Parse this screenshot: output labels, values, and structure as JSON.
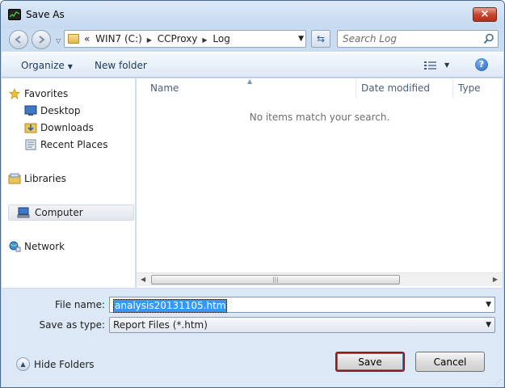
{
  "window": {
    "title": "Save As",
    "close_label": "×"
  },
  "address": {
    "crumbs": [
      "WIN7 (C:)",
      "CCProxy",
      "Log"
    ],
    "overflow": "«"
  },
  "search": {
    "placeholder": "Search Log"
  },
  "toolbar": {
    "organize": "Organize",
    "new_folder": "New folder",
    "help": "?"
  },
  "navpane": {
    "favorites": "Favorites",
    "favorite_items": [
      "Desktop",
      "Downloads",
      "Recent Places"
    ],
    "libraries": "Libraries",
    "computer": "Computer",
    "network": "Network"
  },
  "content": {
    "columns": [
      "Name",
      "Date modified",
      "Type"
    ],
    "empty_message": "No items match your search."
  },
  "form": {
    "file_name_label": "File name:",
    "file_name_value": "analysis20131105.htm",
    "save_type_label": "Save as type:",
    "save_type_value": "Report Files (*.htm)"
  },
  "footer": {
    "hide_folders": "Hide Folders",
    "save": "Save",
    "cancel": "Cancel"
  },
  "colors": {
    "accent": "#3399ff",
    "frame": "#c9dcf0",
    "save_border": "#8b1e1e"
  }
}
